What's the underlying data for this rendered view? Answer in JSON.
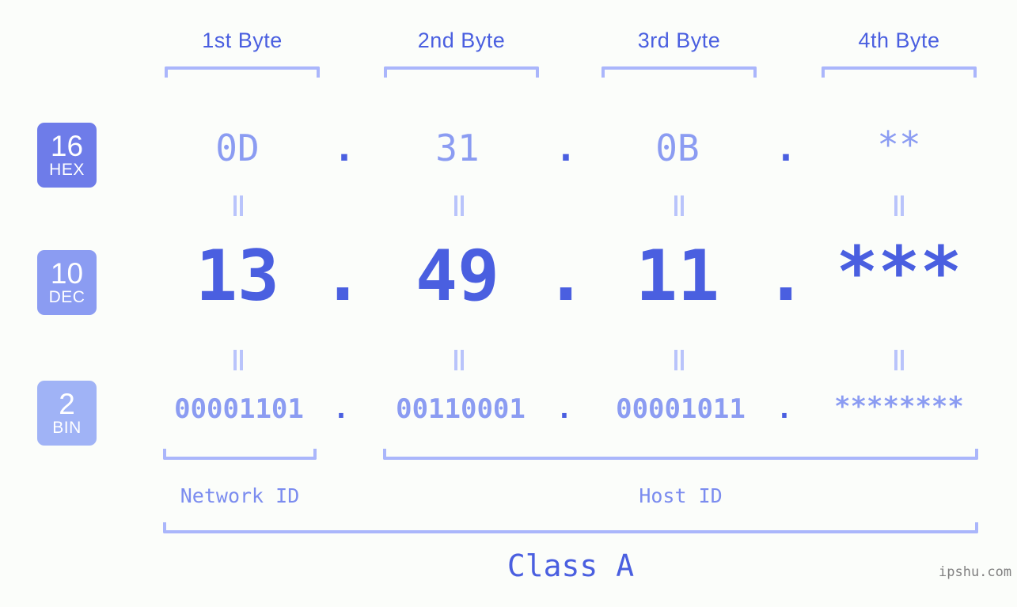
{
  "background_color": "#fbfdfa",
  "accent_colors": {
    "strong_blue": "#4a5fe0",
    "mid_blue": "#8b9cf2",
    "light_blue": "#aab6fb",
    "badge_hex": "#6e7ce9",
    "badge_dec": "#8b9cf2",
    "badge_bin": "#a0b3f6",
    "watermark_gray": "#808080"
  },
  "byte_headers": [
    {
      "label": "1st Byte"
    },
    {
      "label": "2nd Byte"
    },
    {
      "label": "3rd Byte"
    },
    {
      "label": "4th Byte"
    }
  ],
  "base_badges": [
    {
      "number": "16",
      "abbr": "HEX"
    },
    {
      "number": "10",
      "abbr": "DEC"
    },
    {
      "number": "2",
      "abbr": "BIN"
    }
  ],
  "rows": {
    "hex": {
      "base": "16",
      "base_abbr": "HEX",
      "bytes": [
        "0D",
        "31",
        "0B",
        "**"
      ],
      "separator": "."
    },
    "dec": {
      "base": "10",
      "base_abbr": "DEC",
      "bytes": [
        "13",
        "49",
        "11",
        "***"
      ],
      "separator": "."
    },
    "bin": {
      "base": "2",
      "base_abbr": "BIN",
      "bytes": [
        "00001101",
        "00110001",
        "00001011",
        "********"
      ],
      "separator": "."
    }
  },
  "connectors": {
    "glyph": "=",
    "count_per_row_gap": 4,
    "rows": 2
  },
  "regions": [
    {
      "label": "Network ID"
    },
    {
      "label": "Host ID"
    }
  ],
  "class": {
    "label": "Class A"
  },
  "watermark": {
    "text": "ipshu.com"
  }
}
